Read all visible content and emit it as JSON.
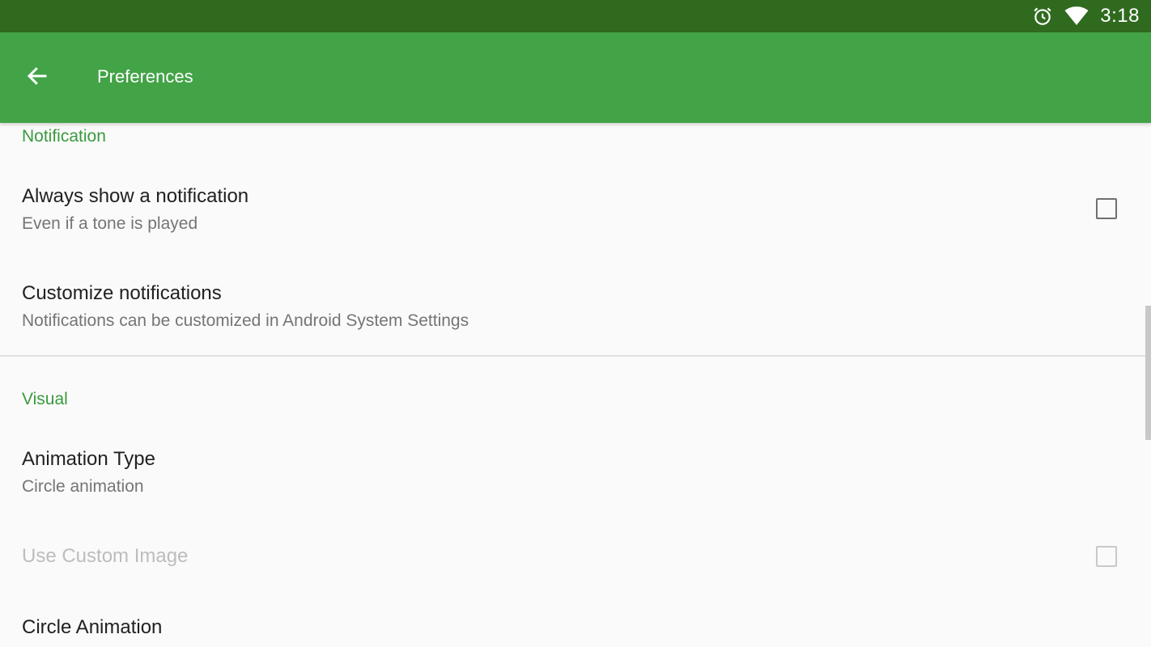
{
  "status_bar": {
    "time": "3:18",
    "icons": [
      "alarm-icon",
      "wifi-icon"
    ]
  },
  "app_bar": {
    "title": "Preferences",
    "back_icon": "arrow-back-icon"
  },
  "colors": {
    "status_bar": "#2f6a1f",
    "app_bar": "#43a347",
    "accent": "#3a9a3d",
    "background": "#fafafa"
  },
  "sections": {
    "notification": {
      "header": "Notification",
      "always_show": {
        "title": "Always show a notification",
        "summary": "Even if a tone is played",
        "checked": false
      },
      "customize": {
        "title": "Customize notifications",
        "summary": "Notifications can be customized in Android System Settings"
      }
    },
    "visual": {
      "header": "Visual",
      "animation_type": {
        "title": "Animation Type",
        "summary": "Circle animation"
      },
      "custom_image": {
        "title": "Use Custom Image",
        "checked": false,
        "enabled": false
      },
      "circle_animation": {
        "title": "Circle Animation"
      }
    }
  }
}
